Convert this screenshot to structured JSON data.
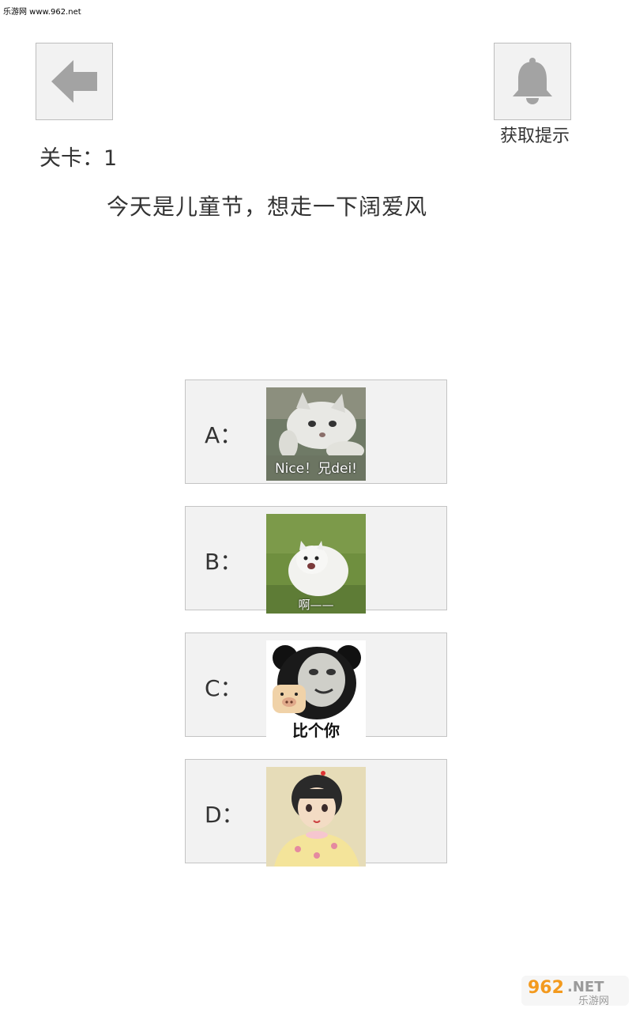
{
  "watermark_top": "乐游网 www.962.net",
  "header": {
    "back_icon": "arrow-left-icon",
    "hint_icon": "bell-icon",
    "hint_label": "获取提示"
  },
  "level": {
    "label": "关卡：1"
  },
  "question": "今天是儿童节，想走一下阔爱风",
  "options": [
    {
      "letter": "A：",
      "caption": "Nice！兄dei!"
    },
    {
      "letter": "B：",
      "caption": "啊——"
    },
    {
      "letter": "C：",
      "caption": "比个你"
    },
    {
      "letter": "D：",
      "caption": ""
    }
  ],
  "watermark_bottom": {
    "top": "962.NET",
    "bottom": "乐游网"
  },
  "colors": {
    "button_bg": "#f2f2f2",
    "icon": "#9e9e9e",
    "text": "#333333"
  }
}
